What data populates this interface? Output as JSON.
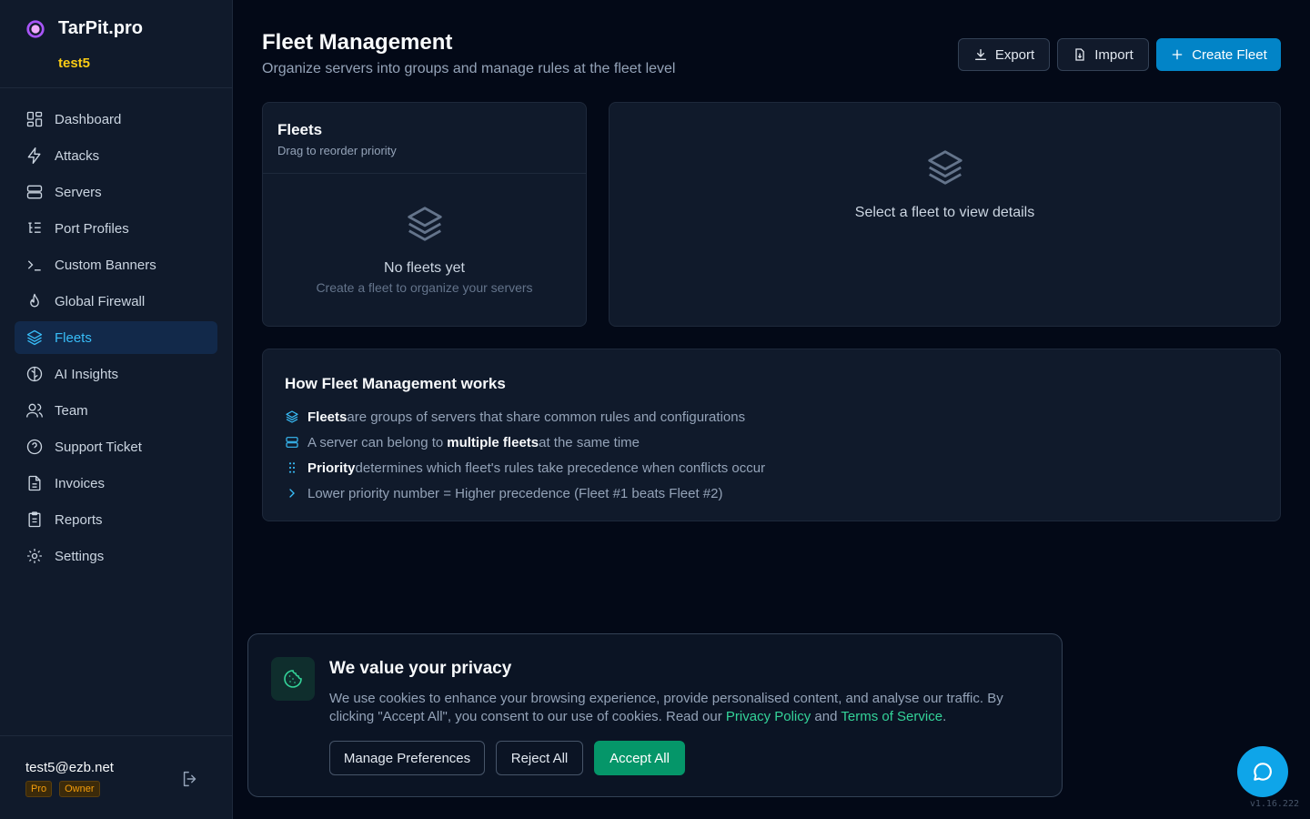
{
  "brand": {
    "name": "TarPit.pro",
    "user": "test5"
  },
  "nav": [
    {
      "label": "Dashboard",
      "icon": "dashboard-icon"
    },
    {
      "label": "Attacks",
      "icon": "bolt-icon"
    },
    {
      "label": "Servers",
      "icon": "server-icon"
    },
    {
      "label": "Port Profiles",
      "icon": "list-tree-icon"
    },
    {
      "label": "Custom Banners",
      "icon": "terminal-icon"
    },
    {
      "label": "Global Firewall",
      "icon": "flame-icon"
    },
    {
      "label": "Fleets",
      "icon": "layers-icon",
      "active": true
    },
    {
      "label": "AI Insights",
      "icon": "brain-icon"
    },
    {
      "label": "Team",
      "icon": "users-icon"
    },
    {
      "label": "Support Ticket",
      "icon": "help-circle-icon"
    },
    {
      "label": "Invoices",
      "icon": "file-text-icon"
    },
    {
      "label": "Reports",
      "icon": "clipboard-icon"
    },
    {
      "label": "Settings",
      "icon": "gear-icon"
    }
  ],
  "footer": {
    "email": "test5@ezb.net",
    "badges": [
      "Pro",
      "Owner"
    ]
  },
  "header": {
    "title": "Fleet Management",
    "subtitle": "Organize servers into groups and manage rules at the fleet level",
    "export_label": "Export",
    "import_label": "Import",
    "create_label": "Create Fleet"
  },
  "fleets_panel": {
    "title": "Fleets",
    "subtitle": "Drag to reorder priority",
    "empty_title": "No fleets yet",
    "empty_subtitle": "Create a fleet to organize your servers"
  },
  "details_panel": {
    "placeholder": "Select a fleet to view details"
  },
  "how": {
    "title": "How Fleet Management works",
    "rows": [
      {
        "parts": [
          {
            "text": "Fleets",
            "bold": true
          },
          {
            "text": "are groups of servers that share common rules and configurations"
          }
        ]
      },
      {
        "parts": [
          {
            "text": "A server can belong to"
          },
          {
            "text": "multiple fleets",
            "bold": true
          },
          {
            "text": "at the same time"
          }
        ]
      },
      {
        "parts": [
          {
            "text": "Priority",
            "bold": true
          },
          {
            "text": "determines which fleet's rules take precedence when conflicts occur"
          }
        ]
      },
      {
        "parts": [
          {
            "text": "Lower priority number = Higher precedence (Fleet #1 beats Fleet #2)"
          }
        ]
      }
    ]
  },
  "cookie": {
    "title": "We value your privacy",
    "body_before": "We use cookies to enhance your browsing experience, provide personalised content, and analyse our traffic. By clicking \"Accept All\", you consent to our use of cookies. Read our",
    "privacy_link": "Privacy Policy",
    "and_text": "and",
    "terms_link": "Terms of Service",
    "period": ".",
    "manage_label": "Manage Preferences",
    "reject_label": "Reject All",
    "accept_label": "Accept All"
  },
  "version": "v1.16.222",
  "colors": {
    "accent": "#0ea5e9",
    "brand_user": "#facc15",
    "accept": "#059669",
    "link": "#34d399"
  }
}
